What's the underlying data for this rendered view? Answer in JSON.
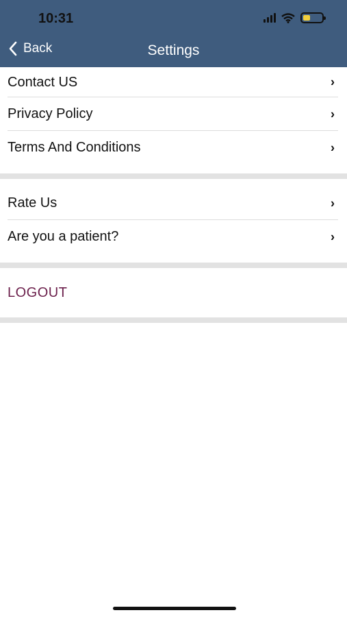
{
  "status": {
    "time": "10:31"
  },
  "nav": {
    "back_label": "Back",
    "title": "Settings"
  },
  "section1": [
    {
      "label": "Contact US"
    },
    {
      "label": "Privacy Policy"
    },
    {
      "label": "Terms And Conditions"
    }
  ],
  "section2": [
    {
      "label": "Rate Us"
    },
    {
      "label": "Are you a patient?"
    }
  ],
  "logout_label": "LOGOUT",
  "chevron": "›",
  "colors": {
    "header_bg": "#3f5c7e",
    "logout_text": "#6b1f4b",
    "section_bar": "#e2e2e2",
    "battery": "#f2cf3c"
  },
  "icons": [
    "back-chevron-icon",
    "chevron-right-icon",
    "signal-icon",
    "wifi-icon",
    "battery-icon"
  ]
}
